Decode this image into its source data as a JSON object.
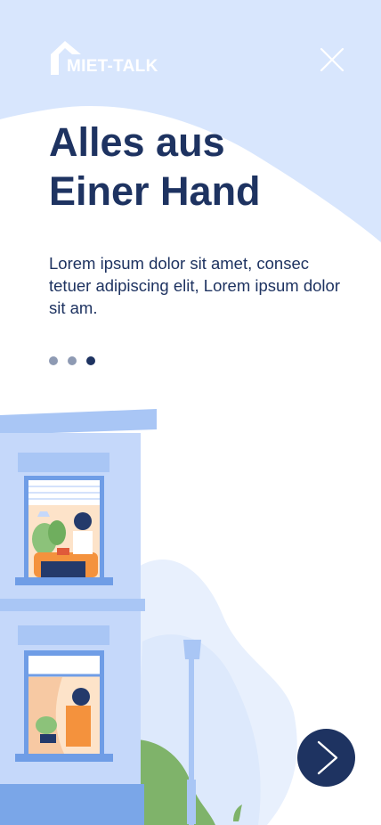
{
  "brand": {
    "logo_text": "MIET-TALK"
  },
  "header": {
    "close_icon": "close-icon"
  },
  "hero": {
    "title_line1": "Alles aus",
    "title_line2": "Einer Hand",
    "description": "Lorem ipsum dolor sit amet, consec tetuer adipiscing elit, Lorem ipsum dolor sit am."
  },
  "pagination": {
    "total": 3,
    "active_index": 2
  },
  "next_button": {
    "icon": "chevron-right-icon"
  },
  "colors": {
    "navy": "#1e3361",
    "light_blue": "#d8e6fd",
    "building": "#c5d8fa",
    "dot_inactive": "#8e9ab3",
    "accent_orange": "#f4923d",
    "plant_green": "#7fb36a"
  }
}
